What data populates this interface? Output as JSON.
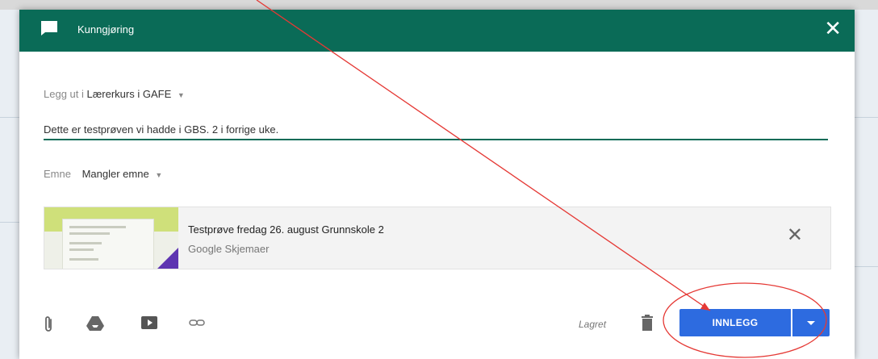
{
  "header": {
    "title": "Kunngjøring",
    "icon": "announcement-icon",
    "close_label": "✕"
  },
  "post_to": {
    "label": "Legg ut i",
    "value": "Lærerkurs i GAFE"
  },
  "post_text": {
    "value": "Dette er testprøven vi hadde i GBS. 2 i forrige uke."
  },
  "topic": {
    "label": "Emne",
    "value": "Mangler emne"
  },
  "attachment": {
    "title": "Testprøve fredag 26. august Grunnskole 2",
    "subtitle": "Google Skjemaer",
    "remove_label": "✕"
  },
  "toolbar": {
    "icons": [
      "attach-file-icon",
      "google-drive-icon",
      "youtube-icon",
      "link-icon"
    ]
  },
  "footer": {
    "saved_label": "Lagret",
    "post_button_label": "INNLEGG"
  },
  "colors": {
    "header": "#0a6b57",
    "primary_button": "#2d6be0",
    "annotation": "#e53935"
  }
}
